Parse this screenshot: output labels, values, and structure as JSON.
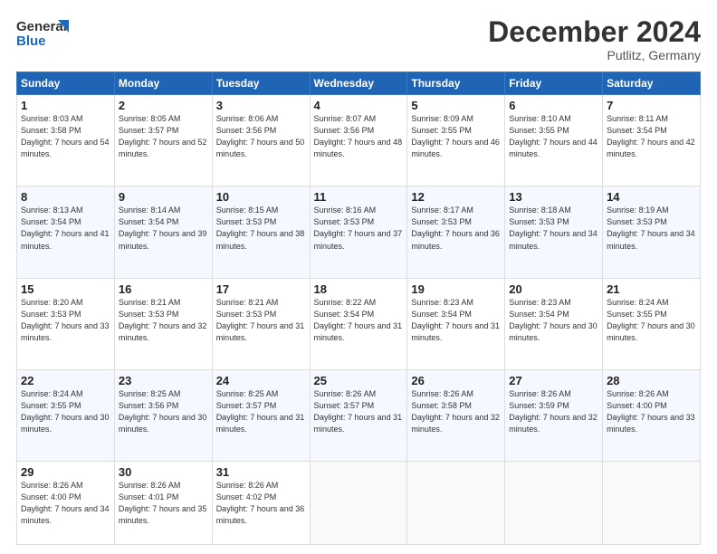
{
  "logo": {
    "line1": "General",
    "line2": "Blue"
  },
  "title": "December 2024",
  "subtitle": "Putlitz, Germany",
  "weekdays": [
    "Sunday",
    "Monday",
    "Tuesday",
    "Wednesday",
    "Thursday",
    "Friday",
    "Saturday"
  ],
  "weeks": [
    [
      {
        "day": "1",
        "sunrise": "Sunrise: 8:03 AM",
        "sunset": "Sunset: 3:58 PM",
        "daylight": "Daylight: 7 hours and 54 minutes."
      },
      {
        "day": "2",
        "sunrise": "Sunrise: 8:05 AM",
        "sunset": "Sunset: 3:57 PM",
        "daylight": "Daylight: 7 hours and 52 minutes."
      },
      {
        "day": "3",
        "sunrise": "Sunrise: 8:06 AM",
        "sunset": "Sunset: 3:56 PM",
        "daylight": "Daylight: 7 hours and 50 minutes."
      },
      {
        "day": "4",
        "sunrise": "Sunrise: 8:07 AM",
        "sunset": "Sunset: 3:56 PM",
        "daylight": "Daylight: 7 hours and 48 minutes."
      },
      {
        "day": "5",
        "sunrise": "Sunrise: 8:09 AM",
        "sunset": "Sunset: 3:55 PM",
        "daylight": "Daylight: 7 hours and 46 minutes."
      },
      {
        "day": "6",
        "sunrise": "Sunrise: 8:10 AM",
        "sunset": "Sunset: 3:55 PM",
        "daylight": "Daylight: 7 hours and 44 minutes."
      },
      {
        "day": "7",
        "sunrise": "Sunrise: 8:11 AM",
        "sunset": "Sunset: 3:54 PM",
        "daylight": "Daylight: 7 hours and 42 minutes."
      }
    ],
    [
      {
        "day": "8",
        "sunrise": "Sunrise: 8:13 AM",
        "sunset": "Sunset: 3:54 PM",
        "daylight": "Daylight: 7 hours and 41 minutes."
      },
      {
        "day": "9",
        "sunrise": "Sunrise: 8:14 AM",
        "sunset": "Sunset: 3:54 PM",
        "daylight": "Daylight: 7 hours and 39 minutes."
      },
      {
        "day": "10",
        "sunrise": "Sunrise: 8:15 AM",
        "sunset": "Sunset: 3:53 PM",
        "daylight": "Daylight: 7 hours and 38 minutes."
      },
      {
        "day": "11",
        "sunrise": "Sunrise: 8:16 AM",
        "sunset": "Sunset: 3:53 PM",
        "daylight": "Daylight: 7 hours and 37 minutes."
      },
      {
        "day": "12",
        "sunrise": "Sunrise: 8:17 AM",
        "sunset": "Sunset: 3:53 PM",
        "daylight": "Daylight: 7 hours and 36 minutes."
      },
      {
        "day": "13",
        "sunrise": "Sunrise: 8:18 AM",
        "sunset": "Sunset: 3:53 PM",
        "daylight": "Daylight: 7 hours and 34 minutes."
      },
      {
        "day": "14",
        "sunrise": "Sunrise: 8:19 AM",
        "sunset": "Sunset: 3:53 PM",
        "daylight": "Daylight: 7 hours and 34 minutes."
      }
    ],
    [
      {
        "day": "15",
        "sunrise": "Sunrise: 8:20 AM",
        "sunset": "Sunset: 3:53 PM",
        "daylight": "Daylight: 7 hours and 33 minutes."
      },
      {
        "day": "16",
        "sunrise": "Sunrise: 8:21 AM",
        "sunset": "Sunset: 3:53 PM",
        "daylight": "Daylight: 7 hours and 32 minutes."
      },
      {
        "day": "17",
        "sunrise": "Sunrise: 8:21 AM",
        "sunset": "Sunset: 3:53 PM",
        "daylight": "Daylight: 7 hours and 31 minutes."
      },
      {
        "day": "18",
        "sunrise": "Sunrise: 8:22 AM",
        "sunset": "Sunset: 3:54 PM",
        "daylight": "Daylight: 7 hours and 31 minutes."
      },
      {
        "day": "19",
        "sunrise": "Sunrise: 8:23 AM",
        "sunset": "Sunset: 3:54 PM",
        "daylight": "Daylight: 7 hours and 31 minutes."
      },
      {
        "day": "20",
        "sunrise": "Sunrise: 8:23 AM",
        "sunset": "Sunset: 3:54 PM",
        "daylight": "Daylight: 7 hours and 30 minutes."
      },
      {
        "day": "21",
        "sunrise": "Sunrise: 8:24 AM",
        "sunset": "Sunset: 3:55 PM",
        "daylight": "Daylight: 7 hours and 30 minutes."
      }
    ],
    [
      {
        "day": "22",
        "sunrise": "Sunrise: 8:24 AM",
        "sunset": "Sunset: 3:55 PM",
        "daylight": "Daylight: 7 hours and 30 minutes."
      },
      {
        "day": "23",
        "sunrise": "Sunrise: 8:25 AM",
        "sunset": "Sunset: 3:56 PM",
        "daylight": "Daylight: 7 hours and 30 minutes."
      },
      {
        "day": "24",
        "sunrise": "Sunrise: 8:25 AM",
        "sunset": "Sunset: 3:57 PM",
        "daylight": "Daylight: 7 hours and 31 minutes."
      },
      {
        "day": "25",
        "sunrise": "Sunrise: 8:26 AM",
        "sunset": "Sunset: 3:57 PM",
        "daylight": "Daylight: 7 hours and 31 minutes."
      },
      {
        "day": "26",
        "sunrise": "Sunrise: 8:26 AM",
        "sunset": "Sunset: 3:58 PM",
        "daylight": "Daylight: 7 hours and 32 minutes."
      },
      {
        "day": "27",
        "sunrise": "Sunrise: 8:26 AM",
        "sunset": "Sunset: 3:59 PM",
        "daylight": "Daylight: 7 hours and 32 minutes."
      },
      {
        "day": "28",
        "sunrise": "Sunrise: 8:26 AM",
        "sunset": "Sunset: 4:00 PM",
        "daylight": "Daylight: 7 hours and 33 minutes."
      }
    ],
    [
      {
        "day": "29",
        "sunrise": "Sunrise: 8:26 AM",
        "sunset": "Sunset: 4:00 PM",
        "daylight": "Daylight: 7 hours and 34 minutes."
      },
      {
        "day": "30",
        "sunrise": "Sunrise: 8:26 AM",
        "sunset": "Sunset: 4:01 PM",
        "daylight": "Daylight: 7 hours and 35 minutes."
      },
      {
        "day": "31",
        "sunrise": "Sunrise: 8:26 AM",
        "sunset": "Sunset: 4:02 PM",
        "daylight": "Daylight: 7 hours and 36 minutes."
      },
      null,
      null,
      null,
      null
    ]
  ]
}
